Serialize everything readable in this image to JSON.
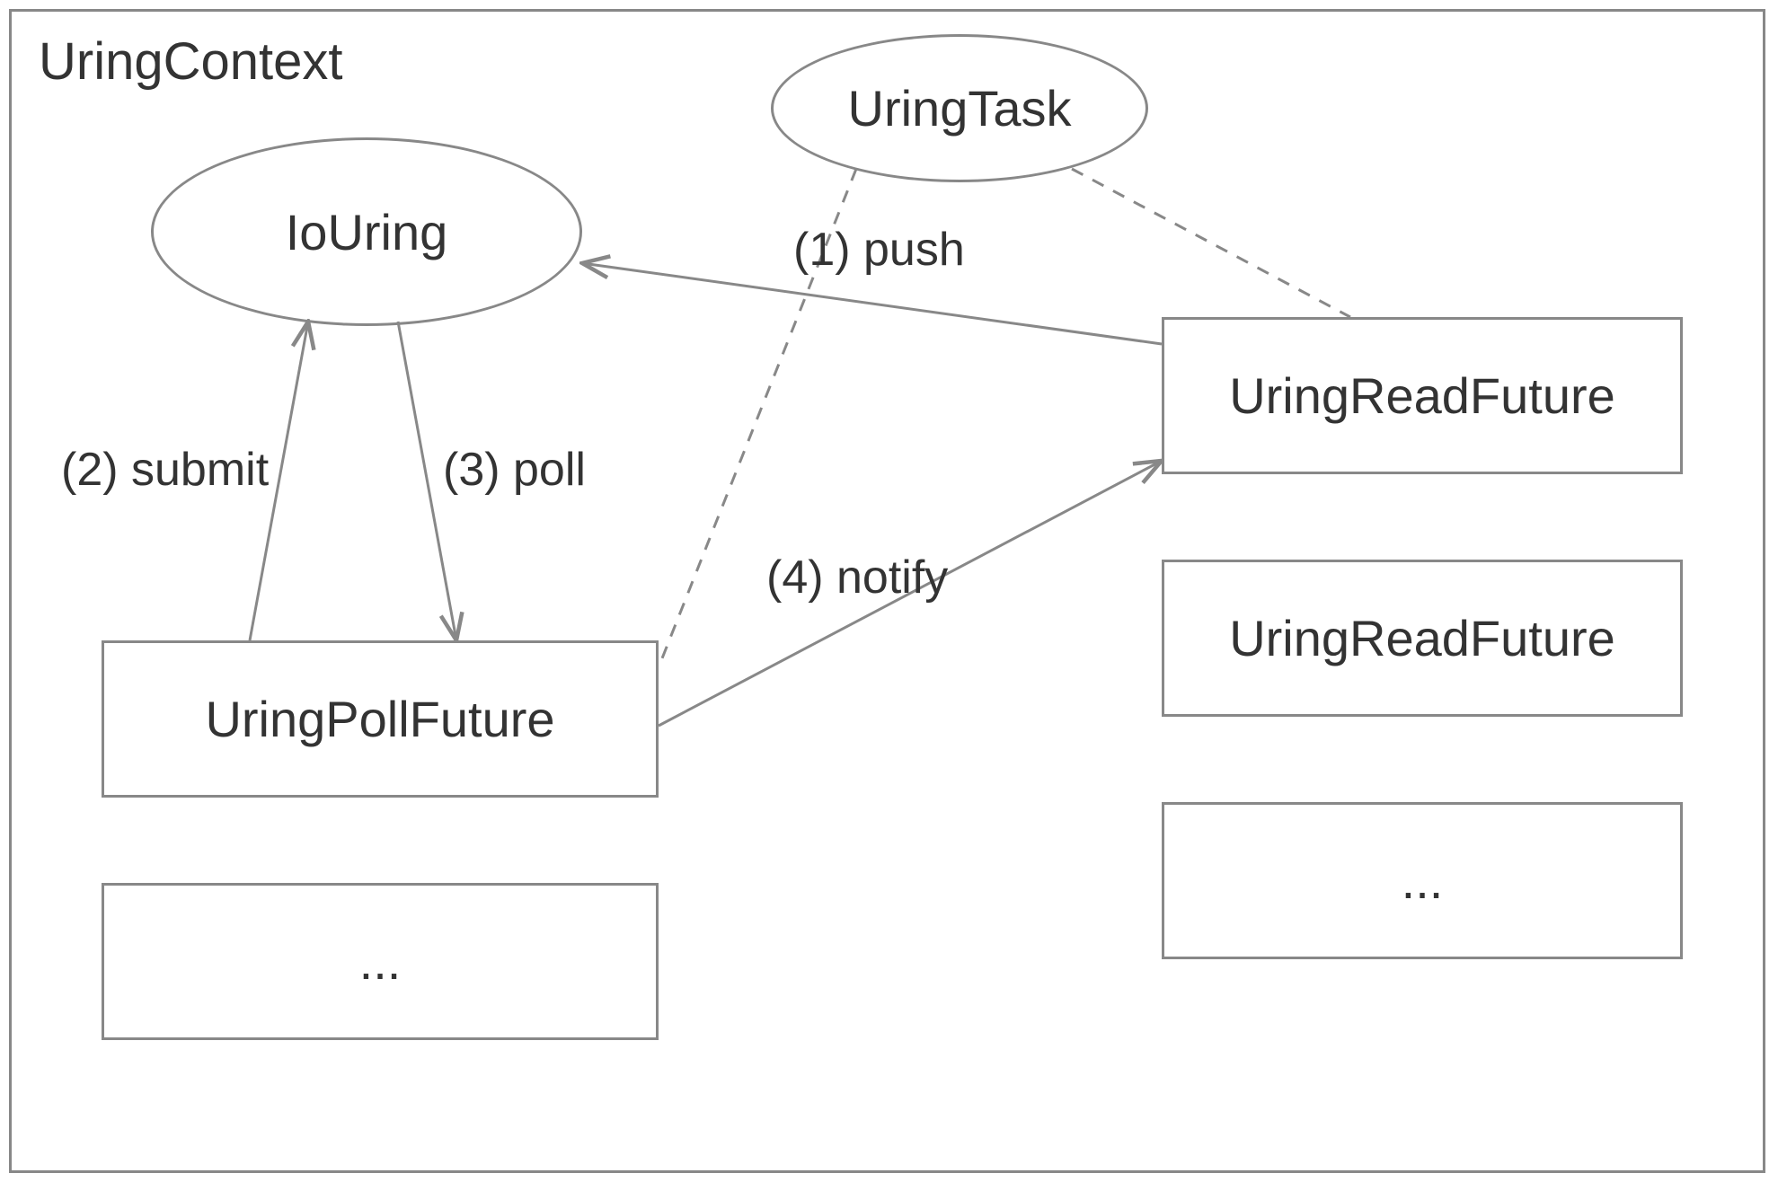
{
  "diagram": {
    "context_label": "UringContext",
    "nodes": {
      "io_uring": "IoUring",
      "uring_task": "UringTask",
      "uring_poll_future": "UringPollFuture",
      "uring_read_future_1": "UringReadFuture",
      "uring_read_future_2": "UringReadFuture",
      "ellipsis_left": "...",
      "ellipsis_right": "..."
    },
    "edges": {
      "push": "(1) push",
      "submit": "(2) submit",
      "poll": "(3) poll",
      "notify": "(4) notify"
    }
  }
}
